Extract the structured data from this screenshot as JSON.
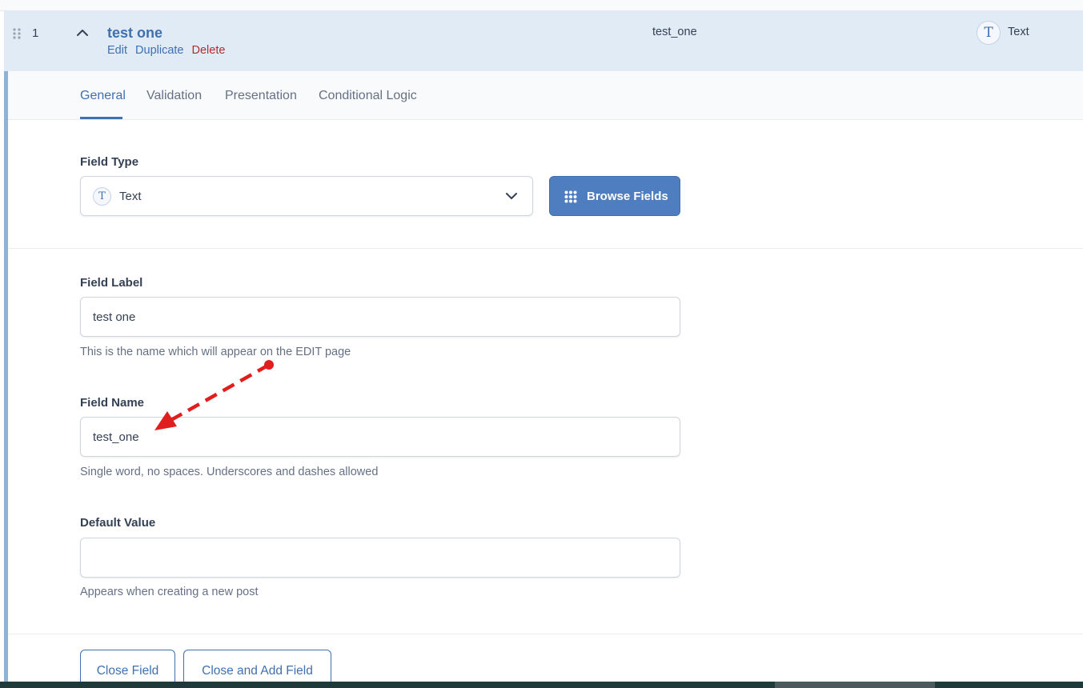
{
  "field_row": {
    "order": "1",
    "label": "test one",
    "actions": {
      "edit": "Edit",
      "duplicate": "Duplicate",
      "delete": "Delete"
    },
    "name": "test_one",
    "type": "Text",
    "type_icon_glyph": "T"
  },
  "tabs": [
    {
      "label": "General",
      "active": true
    },
    {
      "label": "Validation",
      "active": false
    },
    {
      "label": "Presentation",
      "active": false
    },
    {
      "label": "Conditional Logic",
      "active": false
    }
  ],
  "field_type": {
    "label": "Field Type",
    "selected": "Text",
    "icon_glyph": "T",
    "browse_button": "Browse Fields"
  },
  "field_label": {
    "label": "Field Label",
    "value": "test one",
    "hint": "This is the name which will appear on the EDIT page"
  },
  "field_name": {
    "label": "Field Name",
    "value": "test_one",
    "hint": "Single word, no spaces. Underscores and dashes allowed"
  },
  "default_value": {
    "label": "Default Value",
    "value": "",
    "hint": "Appears when creating a new post"
  },
  "footer": {
    "close_field": "Close Field",
    "close_and_add": "Close and Add Field"
  },
  "colors": {
    "accent": "#3f70b0",
    "delete": "#b32d2e",
    "row_highlight": "#e0ebf5",
    "annotation_arrow": "#e01e1e"
  }
}
